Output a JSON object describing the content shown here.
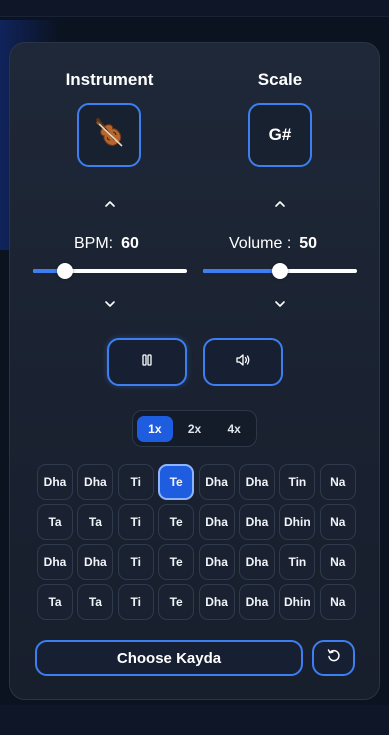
{
  "instrument": {
    "label": "Instrument",
    "selected_icon": "violin-icon"
  },
  "scale": {
    "label": "Scale",
    "value": "G#"
  },
  "bpm": {
    "label": "BPM:",
    "value": "60",
    "slider_fraction": 0.21
  },
  "volume": {
    "label": "Volume :",
    "value": "50",
    "slider_fraction": 0.5
  },
  "playback": {
    "pause_icon": "pause-icon",
    "sound_icon": "volume-icon"
  },
  "speed": {
    "options": [
      "1x",
      "2x",
      "4x"
    ],
    "selected": "1x"
  },
  "bols": [
    [
      "Dha",
      "Dha",
      "Ti",
      "Te",
      "Dha",
      "Dha",
      "Tin",
      "Na"
    ],
    [
      "Ta",
      "Ta",
      "Ti",
      "Te",
      "Dha",
      "Dha",
      "Dhin",
      "Na"
    ],
    [
      "Dha",
      "Dha",
      "Ti",
      "Te",
      "Dha",
      "Dha",
      "Tin",
      "Na"
    ],
    [
      "Ta",
      "Ta",
      "Ti",
      "Te",
      "Dha",
      "Dha",
      "Dhin",
      "Na"
    ]
  ],
  "active_bol": {
    "row": 0,
    "col": 3
  },
  "choose_kayda": {
    "label": "Choose Kayda"
  },
  "reset": {
    "icon": "reset-icon"
  },
  "colors": {
    "accent": "#3d7ff0",
    "active": "#1f5de0",
    "panel": "#1f2838",
    "background": "#0b1220"
  }
}
